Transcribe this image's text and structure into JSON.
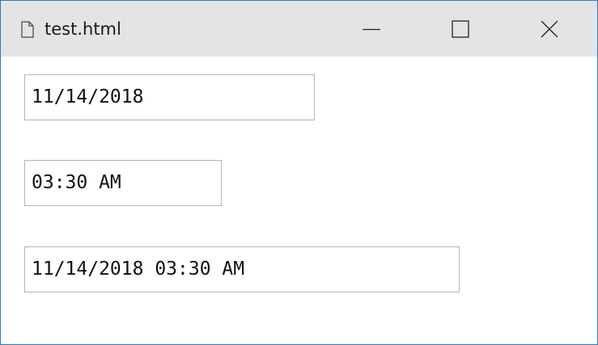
{
  "window": {
    "title": "test.html",
    "title_icon": "document-icon",
    "controls": {
      "minimize_icon": "minimize-icon",
      "maximize_icon": "maximize-icon",
      "close_icon": "close-icon"
    },
    "accent_border_color": "#2b79c9",
    "titlebar_color": "#e3e4e6"
  },
  "fields": {
    "date": {
      "value": "11/14/2018"
    },
    "time": {
      "value": "03:30 AM"
    },
    "datetime": {
      "value": "11/14/2018 03:30 AM"
    }
  }
}
